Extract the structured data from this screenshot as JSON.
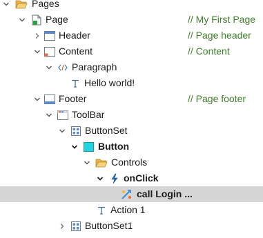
{
  "tree": {
    "pages": {
      "label": "Pages",
      "icon": "folder-open-icon"
    },
    "page": {
      "label": "Page",
      "comment": "// My First Page",
      "icon": "page-file-icon"
    },
    "header": {
      "label": "Header",
      "comment": "// Page header",
      "icon": "window-panel-icon"
    },
    "content": {
      "label": "Content",
      "comment": "// Content",
      "icon": "window-panel-icon"
    },
    "paragraph": {
      "label": "Paragraph",
      "icon": "html-tag-icon"
    },
    "hello_text": {
      "label": "Hello world!",
      "icon": "text-t-icon"
    },
    "footer": {
      "label": "Footer",
      "comment": "// Page footer",
      "icon": "window-panel-icon"
    },
    "toolbar": {
      "label": "ToolBar",
      "icon": "toolbar-icon"
    },
    "buttonset": {
      "label": "ButtonSet",
      "icon": "buttonset-icon"
    },
    "button": {
      "label": "Button",
      "icon": "button-cyan-icon"
    },
    "controls": {
      "label": "Controls",
      "icon": "folder-open-icon"
    },
    "onclick": {
      "label": "onClick",
      "icon": "lightning-icon"
    },
    "call_login": {
      "label": "call Login ...",
      "icon": "action-call-icon"
    },
    "action1": {
      "label": "Action 1",
      "icon": "text-t-icon"
    },
    "buttonset1": {
      "label": "ButtonSet1",
      "icon": "buttonset-icon"
    }
  },
  "colors": {
    "comment": "#3f7f2b",
    "selection": "#d6d6d6",
    "folder": "#f2c464",
    "cyan_button": "#23d3e0",
    "lightning": "#2a6fb7"
  }
}
